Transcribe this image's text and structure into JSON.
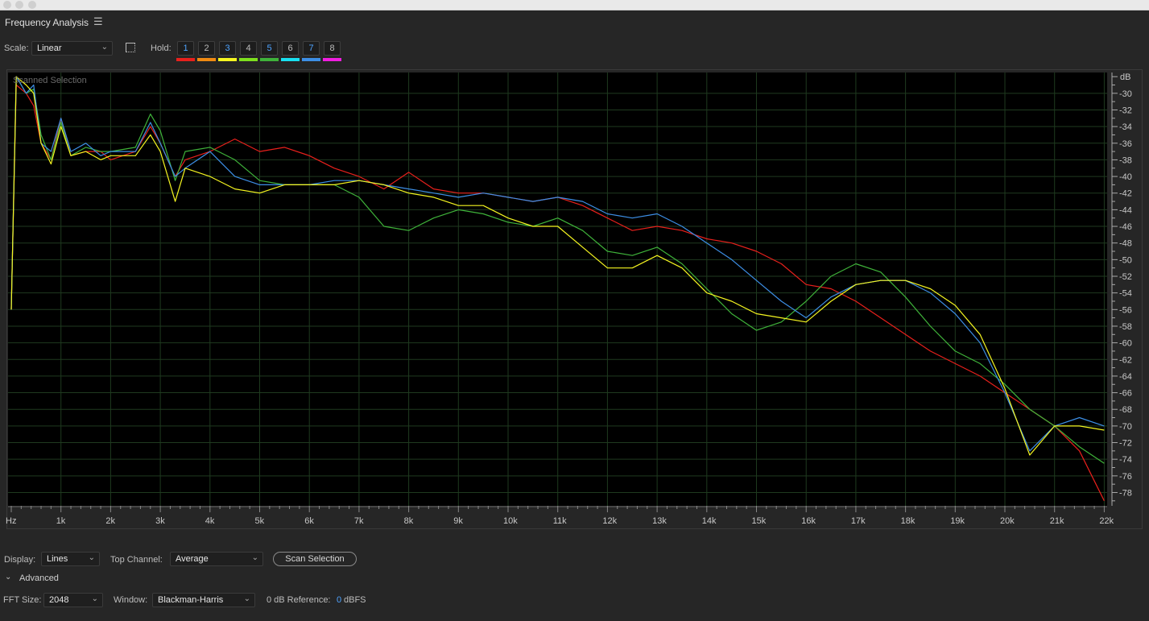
{
  "panel": {
    "title": "Frequency Analysis",
    "menu_icon": "hamburger-icon"
  },
  "toolbar": {
    "scale_label": "Scale:",
    "scale_value": "Linear",
    "marquee_icon": "selection-marquee-icon",
    "hold_label": "Hold:",
    "holds": [
      {
        "label": "1",
        "active": true,
        "color": "#e8201c"
      },
      {
        "label": "2",
        "active": false,
        "color": "#f08a12"
      },
      {
        "label": "3",
        "active": true,
        "color": "#f5f520"
      },
      {
        "label": "4",
        "active": false,
        "color": "#7ee01e"
      },
      {
        "label": "5",
        "active": true,
        "color": "#3fb33a"
      },
      {
        "label": "6",
        "active": false,
        "color": "#19e0f0"
      },
      {
        "label": "7",
        "active": true,
        "color": "#3d8fe6"
      },
      {
        "label": "8",
        "active": false,
        "color": "#f01ee0"
      }
    ]
  },
  "chart_data": {
    "type": "line",
    "overlay_label": "Scanned Selection",
    "xlabel": "Hz",
    "ylabel": "dB",
    "xunit": "kHz",
    "xlim": [
      0,
      22.05
    ],
    "ylim": [
      -79.6,
      -27.5
    ],
    "grid": true,
    "x_ticks": [
      "Hz",
      "1k",
      "2k",
      "3k",
      "4k",
      "5k",
      "6k",
      "7k",
      "8k",
      "9k",
      "10k",
      "11k",
      "12k",
      "13k",
      "14k",
      "15k",
      "16k",
      "17k",
      "18k",
      "19k",
      "20k",
      "21k",
      "22k"
    ],
    "y_ticks": [
      -30,
      -32,
      -34,
      -36,
      -38,
      -40,
      -42,
      -44,
      -46,
      -48,
      -50,
      -52,
      -54,
      -56,
      -58,
      -60,
      -62,
      -64,
      -66,
      -68,
      -70,
      -72,
      -74,
      -76,
      -78
    ],
    "x": [
      0,
      0.1,
      0.3,
      0.45,
      0.6,
      0.8,
      1.0,
      1.2,
      1.5,
      1.8,
      2,
      2.5,
      2.8,
      3,
      3.3,
      3.5,
      4,
      4.5,
      5,
      5.5,
      6,
      6.5,
      7,
      7.5,
      8,
      8.5,
      9,
      9.5,
      10,
      10.5,
      11,
      11.5,
      12,
      12.5,
      13,
      13.5,
      14,
      14.5,
      15,
      15.5,
      16,
      16.5,
      17,
      17.5,
      18,
      18.5,
      19,
      19.5,
      20,
      20.5,
      21,
      21.5,
      22
    ],
    "series": [
      {
        "hold": "1",
        "color": "#e8201c",
        "values": [
          -56,
          -29,
          -30,
          -31.5,
          -36,
          -38,
          -33,
          -37.5,
          -37,
          -37,
          -38,
          -37,
          -34,
          -36,
          -40,
          -38,
          -37,
          -35.5,
          -37,
          -36.5,
          -37.5,
          -39,
          -40,
          -41.5,
          -39.5,
          -41.5,
          -42,
          -42,
          -42.5,
          -43,
          -42.5,
          -43.5,
          -45,
          -46.5,
          -46,
          -46.5,
          -47.5,
          -48,
          -49,
          -50.5,
          -53,
          -53.5,
          -55,
          -57,
          -59,
          -61,
          -62.5,
          -64,
          -66,
          -68,
          -70,
          -73,
          -79
        ]
      },
      {
        "hold": "5",
        "color": "#3fb33a",
        "values": [
          -56,
          -28,
          -30,
          -29.5,
          -35,
          -38,
          -33.5,
          -37.5,
          -36.5,
          -37,
          -37,
          -36.5,
          -32.5,
          -34.5,
          -40.5,
          -37,
          -36.5,
          -38,
          -40.5,
          -41,
          -41,
          -41,
          -42.5,
          -46,
          -46.5,
          -45,
          -44,
          -44.5,
          -45.5,
          -46,
          -45,
          -46.5,
          -49,
          -49.5,
          -48.5,
          -50.5,
          -53.5,
          -56.5,
          -58.5,
          -57.5,
          -55,
          -52,
          -50.5,
          -51.5,
          -54.5,
          -58,
          -61,
          -62.5,
          -65,
          -68,
          -70,
          -72.5,
          -74.5
        ]
      },
      {
        "hold": "7",
        "color": "#3d8fe6",
        "values": [
          -56,
          -28,
          -30,
          -29,
          -36,
          -37,
          -33,
          -37,
          -36,
          -37.5,
          -37,
          -37,
          -33.5,
          -36,
          -40,
          -39,
          -37,
          -40,
          -41,
          -41,
          -41,
          -40.5,
          -40.5,
          -41,
          -41.5,
          -42,
          -42.5,
          -42,
          -42.5,
          -43,
          -42.5,
          -43,
          -44.5,
          -45,
          -44.5,
          -46,
          -48,
          -50,
          -52.5,
          -55,
          -57,
          -54.5,
          -53,
          -52.5,
          -52.5,
          -54,
          -56.5,
          -60,
          -66,
          -73,
          -70,
          -69,
          -70
        ]
      },
      {
        "hold": "3",
        "color": "#f5f520",
        "values": [
          -56,
          -28,
          -29,
          -30,
          -36,
          -38.5,
          -34,
          -37.5,
          -37,
          -38,
          -37.5,
          -37.5,
          -35,
          -37,
          -43,
          -39,
          -40,
          -41.5,
          -42,
          -41,
          -41,
          -41,
          -40.5,
          -41,
          -42,
          -42.5,
          -43.5,
          -43.5,
          -45,
          -46,
          -46,
          -48.5,
          -51,
          -51,
          -49.5,
          -51,
          -54,
          -55,
          -56.5,
          -57,
          -57.5,
          -55,
          -53,
          -52.5,
          -52.5,
          -53.5,
          -55.5,
          -59,
          -65.5,
          -73.5,
          -70,
          -70,
          -70.5
        ]
      }
    ]
  },
  "controls": {
    "display_label": "Display:",
    "display_value": "Lines",
    "top_channel_label": "Top Channel:",
    "top_channel_value": "Average",
    "scan_button": "Scan Selection",
    "advanced_label": "Advanced",
    "fft_label": "FFT Size:",
    "fft_value": "2048",
    "window_label": "Window:",
    "window_value": "Blackman-Harris",
    "reference_label": "0 dB Reference:",
    "reference_value": "0",
    "reference_unit": "dBFS"
  }
}
